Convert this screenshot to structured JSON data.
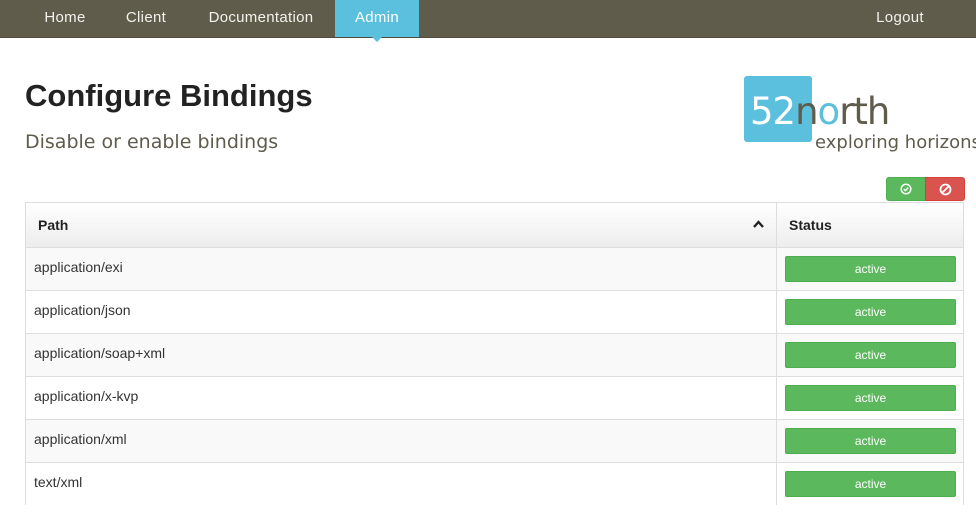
{
  "nav": {
    "items": [
      {
        "label": "Home",
        "active": false
      },
      {
        "label": "Client",
        "active": false
      },
      {
        "label": "Documentation",
        "active": false
      },
      {
        "label": "Admin",
        "active": true
      }
    ],
    "logout_label": "Logout"
  },
  "header": {
    "title": "Configure Bindings",
    "subtitle": "Disable or enable bindings"
  },
  "logo": {
    "number": "52",
    "name_o": "o",
    "name_rest": "rth",
    "name_n": "n",
    "tagline": "exploring horizons"
  },
  "bulk_actions": {
    "activate_all_icon": "check-circle-icon",
    "deactivate_all_icon": "ban-icon"
  },
  "table": {
    "columns": {
      "path": "Path",
      "status": "Status"
    },
    "sort": "ascending",
    "rows": [
      {
        "path": "application/exi",
        "status": "active"
      },
      {
        "path": "application/json",
        "status": "active"
      },
      {
        "path": "application/soap+xml",
        "status": "active"
      },
      {
        "path": "application/x-kvp",
        "status": "active"
      },
      {
        "path": "application/xml",
        "status": "active"
      },
      {
        "path": "text/xml",
        "status": "active"
      }
    ]
  },
  "colors": {
    "navbar": "#5f5c4c",
    "accent": "#5bc0de",
    "success": "#5cb85c",
    "danger": "#d9534f"
  }
}
